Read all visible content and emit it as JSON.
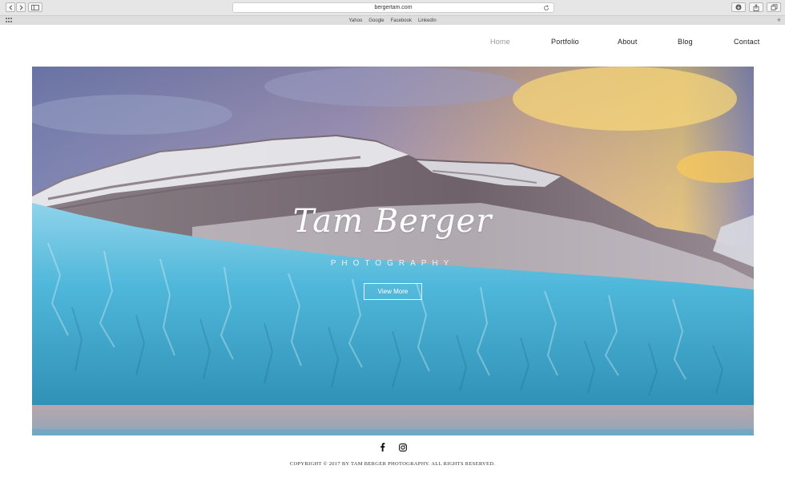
{
  "browser": {
    "url": "bergertam.com",
    "bookmarks": [
      "Yahoo",
      "Google",
      "Facebook",
      "LinkedIn"
    ],
    "icons": [
      "back-icon",
      "forward-icon",
      "sidebar-icon",
      "reload-icon",
      "download-icon",
      "share-icon",
      "tabs-icon",
      "apps-grid-icon",
      "add-tab-icon"
    ]
  },
  "nav": {
    "items": [
      {
        "label": "Home",
        "active": true
      },
      {
        "label": "Portfolio",
        "active": false
      },
      {
        "label": "About",
        "active": false
      },
      {
        "label": "Blog",
        "active": false
      },
      {
        "label": "Contact",
        "active": false
      }
    ]
  },
  "hero": {
    "title": "Tam Berger",
    "subtitle": "PHOTOGRAPHY",
    "button_label": "View More",
    "colors": {
      "ice": "#4fb7da",
      "sky_warm": "#f5c86a",
      "sky_cool": "#7d86b6"
    }
  },
  "footer": {
    "social_icons": [
      "facebook-icon",
      "instagram-icon"
    ],
    "copyright": "COPYRIGHT © 2017 BY TAM BERGER PHOTOGRAPHY. ALL RIGHTS RESERVED."
  }
}
